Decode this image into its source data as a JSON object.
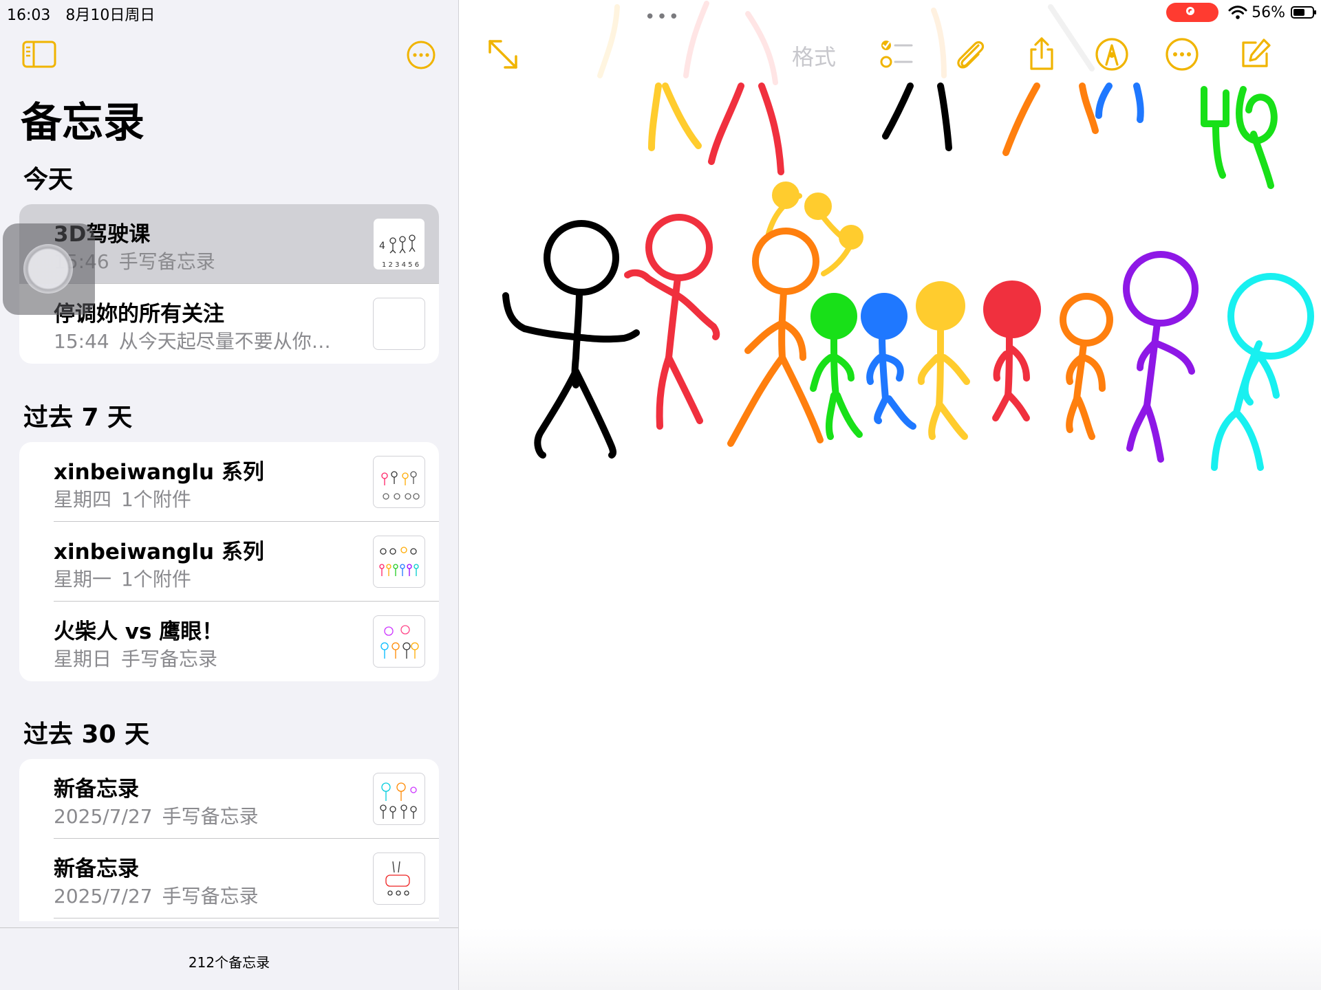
{
  "status_bar": {
    "time": "16:03",
    "date": "8月10日周日",
    "wifi_icon": "wifi-icon",
    "battery_percent": "56%",
    "battery_level": 0.56
  },
  "sidebar": {
    "title": "备忘录",
    "sections": [
      {
        "header": "今天",
        "notes": [
          {
            "title": "3D驾驶课",
            "time": "15:46",
            "detail": "手写备忘录",
            "selected": true
          },
          {
            "title": "停调妳的所有关注",
            "time": "15:44",
            "detail": "从今天起尽量不要从你…"
          }
        ]
      },
      {
        "header": "过去 7 天",
        "notes": [
          {
            "title": "xinbeiwanglu 系列",
            "time": "星期四",
            "detail": "1个附件"
          },
          {
            "title": "xinbeiwanglu 系列",
            "time": "星期一",
            "detail": "1个附件"
          },
          {
            "title": "火柴人 vs 鹰眼！",
            "time": "星期日",
            "detail": "手写备忘录"
          }
        ]
      },
      {
        "header": "过去 30 天",
        "notes": [
          {
            "title": "新备忘录",
            "time": "2025/7/27",
            "detail": "手写备忘录"
          },
          {
            "title": "新备忘录",
            "time": "2025/7/27",
            "detail": "手写备忘录"
          }
        ]
      }
    ],
    "note_count": "212个备忘录"
  },
  "toolbar": {
    "format_label": "格式",
    "icons": [
      "expand-icon",
      "checklist-icon",
      "paperclip-icon",
      "share-icon",
      "markup-pen-icon",
      "more-icon",
      "compose-icon"
    ]
  },
  "colors": {
    "accent": "#f0b400",
    "sidebar_bg": "#f2f2f7",
    "record_indicator": "#ff3b30",
    "stick_figures": [
      "#000000",
      "#f0303e",
      "#ff7f0e",
      "#18e018",
      "#1f78ff",
      "#ffcc2e",
      "#f0303e",
      "#ff7f0e",
      "#8e18e6",
      "#18f0f0"
    ]
  }
}
